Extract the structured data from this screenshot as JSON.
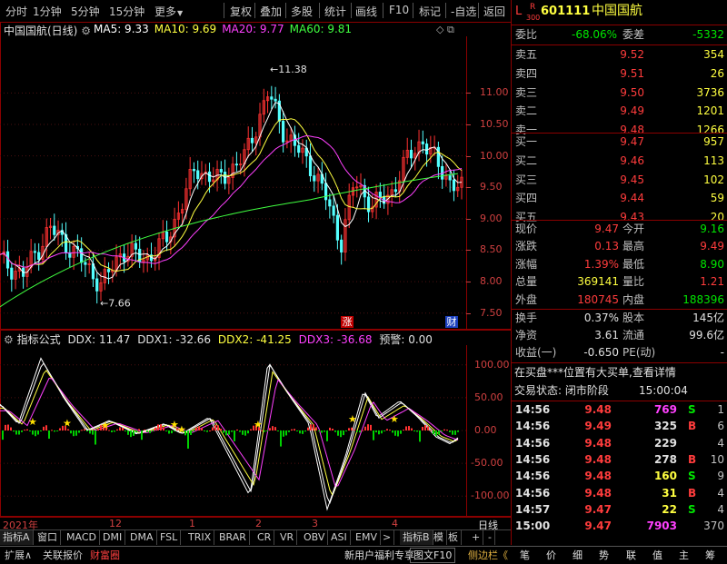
{
  "toolbar": {
    "items": [
      "分时",
      "1分钟",
      "5分钟",
      "15分钟",
      "更多",
      "复权",
      "叠加",
      "多股",
      "统计",
      "画线",
      "F10",
      "标记",
      "-自选",
      "返回"
    ]
  },
  "main_chart": {
    "title": "中国国航(日线)",
    "ma": [
      {
        "label": "MA5: 9.33",
        "color": "#ffffff"
      },
      {
        "label": "MA10: 9.69",
        "color": "#ffff40"
      },
      {
        "label": "MA20: 9.77",
        "color": "#ff40ff"
      },
      {
        "label": "MA60: 9.81",
        "color": "#40ff40"
      }
    ],
    "high_marker": "11.38",
    "low_marker": "7.66",
    "yticks": [
      "11.00",
      "10.50",
      "10.00",
      "9.50",
      "9.00",
      "8.50",
      "8.00",
      "7.50"
    ],
    "tag_zhang": "涨",
    "tag_cai": "财"
  },
  "indicator": {
    "title": "指标公式",
    "ddx": "DDX: 11.47",
    "ddx1": "DDX1: -32.66",
    "ddx2": "DDX2: -41.25",
    "ddx3": "DDX3: -36.68",
    "warn": "预警: 0.00",
    "yticks": [
      "100.00",
      "50.00",
      "0.00",
      "-50.00",
      "-100.00"
    ]
  },
  "timeaxis": {
    "year": "2021年",
    "months": [
      "12",
      "1",
      "2",
      "3",
      "4"
    ],
    "period": "日线"
  },
  "tabs": [
    "指标A",
    "窗口",
    "MACD",
    "DMI",
    "DMA",
    "FSL",
    "TRIX",
    "BRAR",
    "CR",
    "VR",
    "OBV",
    "ASI",
    "EMV",
    ">",
    "指标B",
    "模",
    "板",
    "+",
    "-"
  ],
  "status": {
    "left": [
      "扩展∧",
      "关联报价",
      "财富圈"
    ],
    "promo": "新用户福利专享",
    "tuwen": "图文F10",
    "sidebar": "侧边栏《",
    "right_tabs": [
      "笔",
      "价",
      "细",
      "势",
      "联",
      "值",
      "主",
      "筹"
    ]
  },
  "quote": {
    "prefix": "L",
    "r300_top": "R",
    "r300_bottom": "300",
    "code": "601111",
    "name": "中国国航",
    "weibi_label": "委比",
    "weibi_value": "-68.06%",
    "weicha_label": "委差",
    "weicha_value": "-5332",
    "sells": [
      {
        "label": "卖五",
        "price": "9.52",
        "vol": "354"
      },
      {
        "label": "卖四",
        "price": "9.51",
        "vol": "26"
      },
      {
        "label": "卖三",
        "price": "9.50",
        "vol": "3736"
      },
      {
        "label": "卖二",
        "price": "9.49",
        "vol": "1201"
      },
      {
        "label": "卖一",
        "price": "9.48",
        "vol": "1266"
      }
    ],
    "buys": [
      {
        "label": "买一",
        "price": "9.47",
        "vol": "957"
      },
      {
        "label": "买二",
        "price": "9.46",
        "vol": "113"
      },
      {
        "label": "买三",
        "price": "9.45",
        "vol": "102"
      },
      {
        "label": "买四",
        "price": "9.44",
        "vol": "59"
      },
      {
        "label": "买五",
        "price": "9.43",
        "vol": "20"
      }
    ],
    "stats": [
      {
        "l1": "现价",
        "v1": "9.47",
        "c1": "red",
        "l2": "今开",
        "v2": "9.16",
        "c2": "green"
      },
      {
        "l1": "涨跌",
        "v1": "0.13",
        "c1": "red",
        "l2": "最高",
        "v2": "9.49",
        "c2": "red"
      },
      {
        "l1": "涨幅",
        "v1": "1.39%",
        "c1": "red",
        "l2": "最低",
        "v2": "8.90",
        "c2": "green"
      },
      {
        "l1": "总量",
        "v1": "369141",
        "c1": "yellow",
        "l2": "量比",
        "v2": "1.21",
        "c2": "red"
      },
      {
        "l1": "外盘",
        "v1": "180745",
        "c1": "red",
        "l2": "内盘",
        "v2": "188396",
        "c2": "green"
      }
    ],
    "stats2": [
      {
        "l1": "换手",
        "v1": "0.37%",
        "l2": "股本",
        "v2": "145亿"
      },
      {
        "l1": "净资",
        "v1": "3.61",
        "l2": "流通",
        "v2": "99.6亿"
      },
      {
        "l1": "收益(一)",
        "v1": "-0.650",
        "l2": "PE(动)",
        "v2": "-"
      }
    ],
    "notice": "在买盘***位置有大买单,查看详情",
    "trade_state": "交易状态: 闭市阶段",
    "trade_time": "15:00:04",
    "ticks": [
      {
        "t": "14:56",
        "p": "9.48",
        "v": "769",
        "f": "S",
        "n": "1",
        "vc": "magenta",
        "fc": "green"
      },
      {
        "t": "14:56",
        "p": "9.49",
        "v": "325",
        "f": "B",
        "n": "6",
        "vc": "white",
        "fc": "red"
      },
      {
        "t": "14:56",
        "p": "9.48",
        "v": "229",
        "f": "",
        "n": "4",
        "vc": "white",
        "fc": "white"
      },
      {
        "t": "14:56",
        "p": "9.48",
        "v": "278",
        "f": "B",
        "n": "10",
        "vc": "white",
        "fc": "red"
      },
      {
        "t": "14:56",
        "p": "9.48",
        "v": "160",
        "f": "S",
        "n": "9",
        "vc": "yellow",
        "fc": "green"
      },
      {
        "t": "14:56",
        "p": "9.48",
        "v": "31",
        "f": "B",
        "n": "4",
        "vc": "yellow",
        "fc": "red"
      },
      {
        "t": "14:57",
        "p": "9.47",
        "v": "22",
        "f": "S",
        "n": "4",
        "vc": "yellow",
        "fc": "green"
      },
      {
        "t": "15:00",
        "p": "9.47",
        "v": "7903",
        "f": "",
        "n": "370",
        "vc": "magenta",
        "fc": "white"
      }
    ]
  }
}
